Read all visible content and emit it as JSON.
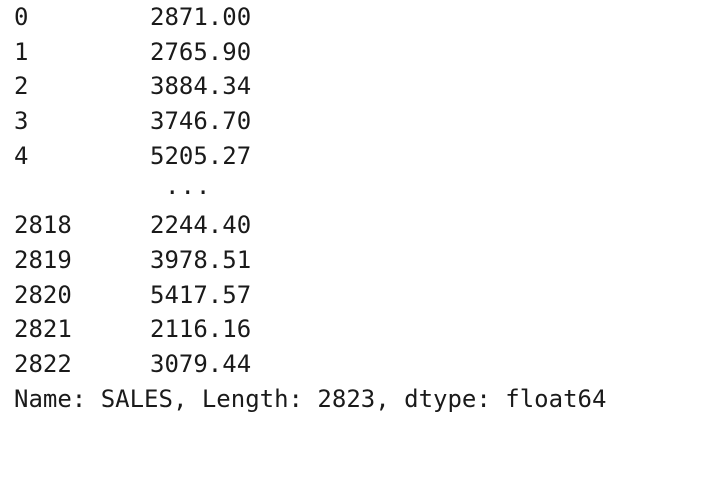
{
  "output": {
    "head_rows": [
      {
        "index": "0",
        "value": "2871.00"
      },
      {
        "index": "1",
        "value": "2765.90"
      },
      {
        "index": "2",
        "value": "3884.34"
      },
      {
        "index": "3",
        "value": "3746.70"
      },
      {
        "index": "4",
        "value": "5205.27"
      }
    ],
    "ellipsis": "...",
    "tail_rows": [
      {
        "index": "2818",
        "value": "2244.40"
      },
      {
        "index": "2819",
        "value": "3978.51"
      },
      {
        "index": "2820",
        "value": "5417.57"
      },
      {
        "index": "2821",
        "value": "2116.16"
      },
      {
        "index": "2822",
        "value": "3079.44"
      }
    ],
    "footer": "Name: SALES, Length: 2823, dtype: float64"
  }
}
